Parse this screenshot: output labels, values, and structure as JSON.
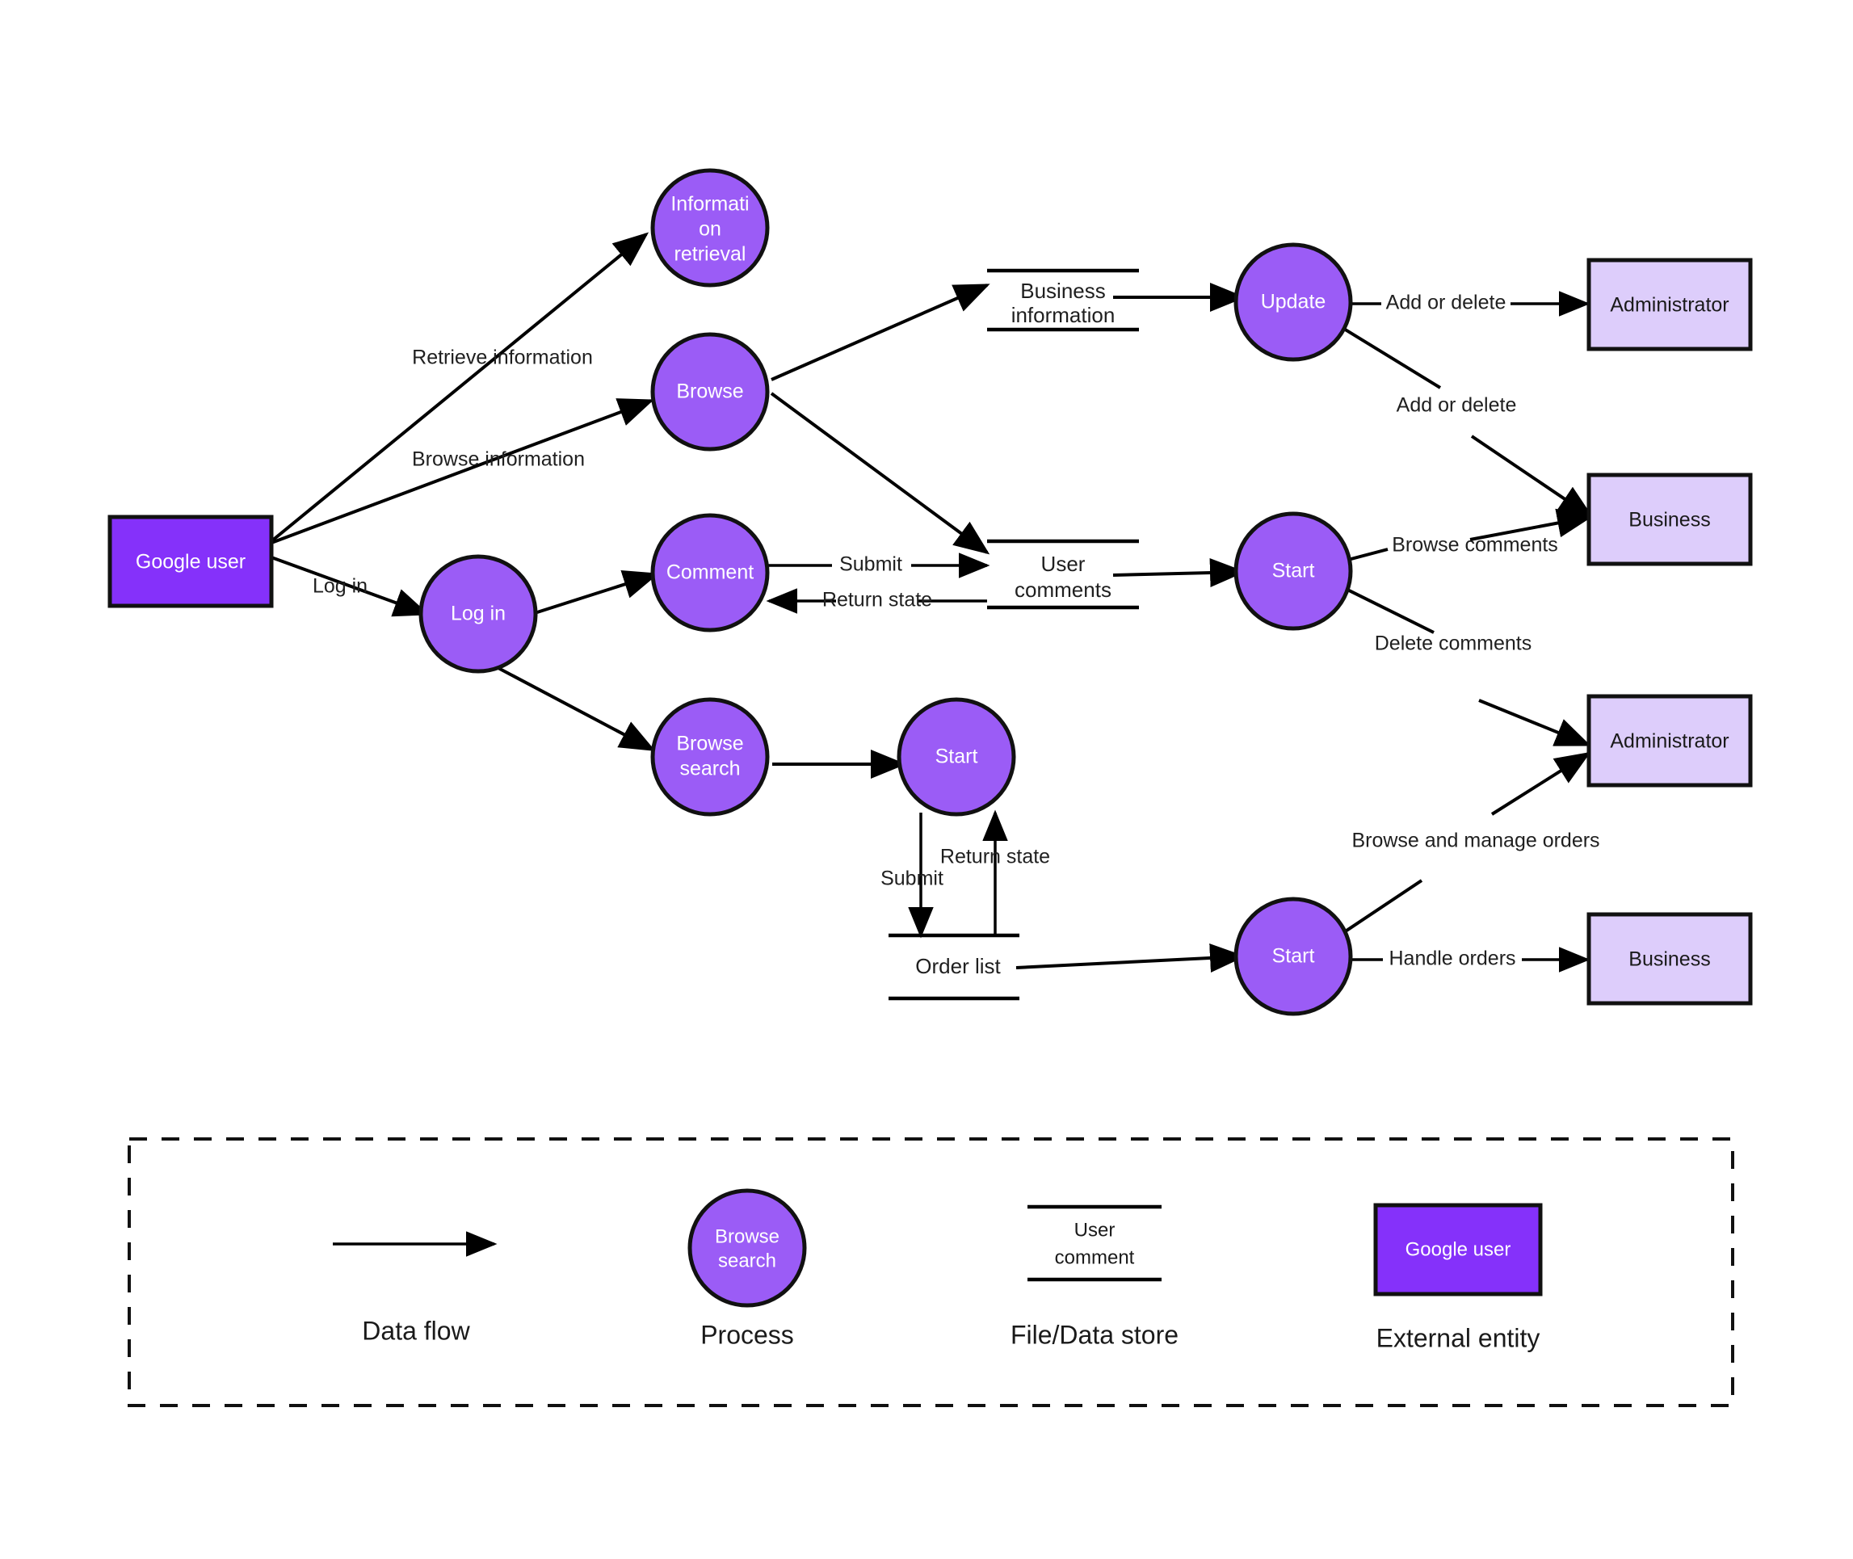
{
  "diagram": {
    "title": "Data Flow Diagram",
    "background_color": "#ffffff",
    "colors": {
      "process_fill": "#9b5cf6",
      "external_entity_fill": "#8531fa",
      "external_entity_light_fill": "#ddcdfb",
      "stroke": "#111111",
      "text_on_dark": "#ffffff",
      "text_on_light": "#1a1a1a"
    }
  },
  "external_entities": [
    {
      "id": "google_user",
      "label": "Google user",
      "variant": "strong"
    },
    {
      "id": "administrator_top",
      "label": "Administrator",
      "variant": "light"
    },
    {
      "id": "business_top",
      "label": "Business",
      "variant": "light"
    },
    {
      "id": "administrator_bottom",
      "label": "Administrator",
      "variant": "light"
    },
    {
      "id": "business_bottom",
      "label": "Business",
      "variant": "light"
    }
  ],
  "processes": [
    {
      "id": "information_retrieval",
      "lines": [
        "Informati",
        "on",
        "retrieval"
      ]
    },
    {
      "id": "browse",
      "lines": [
        "Browse"
      ]
    },
    {
      "id": "log_in",
      "lines": [
        "Log in"
      ]
    },
    {
      "id": "comment",
      "lines": [
        "Comment"
      ]
    },
    {
      "id": "browse_search",
      "lines": [
        "Browse",
        "search"
      ]
    },
    {
      "id": "update",
      "lines": [
        "Update"
      ]
    },
    {
      "id": "start_comments",
      "lines": [
        "Start"
      ]
    },
    {
      "id": "start_search",
      "lines": [
        "Start"
      ]
    },
    {
      "id": "start_orders",
      "lines": [
        "Start"
      ]
    }
  ],
  "data_stores": [
    {
      "id": "business_information",
      "lines": [
        "Business",
        "information"
      ]
    },
    {
      "id": "user_comments",
      "lines": [
        "User",
        "comments"
      ]
    },
    {
      "id": "order_list",
      "lines": [
        "Order list"
      ]
    }
  ],
  "flows": [
    {
      "id": "retrieve_information",
      "label": "Retrieve information",
      "from": "google_user",
      "to": "information_retrieval"
    },
    {
      "id": "browse_information",
      "label": "Browse information",
      "from": "google_user",
      "to": "browse"
    },
    {
      "id": "log_in_flow",
      "label": "Log in",
      "from": "google_user",
      "to": "log_in"
    },
    {
      "id": "browse_to_business_information",
      "label": "",
      "from": "browse",
      "to": "business_information"
    },
    {
      "id": "browse_to_user_comments",
      "label": "",
      "from": "browse",
      "to": "user_comments"
    },
    {
      "id": "log_in_to_comment",
      "label": "",
      "from": "log_in",
      "to": "comment"
    },
    {
      "id": "log_in_to_browse_search",
      "label": "",
      "from": "log_in",
      "to": "browse_search"
    },
    {
      "id": "comment_submit",
      "label": "Submit",
      "from": "comment",
      "to": "user_comments"
    },
    {
      "id": "comment_return_state",
      "label": "Return state",
      "from": "user_comments",
      "to": "comment"
    },
    {
      "id": "browse_search_to_start",
      "label": "",
      "from": "browse_search",
      "to": "start_search"
    },
    {
      "id": "search_submit",
      "label": "Submit",
      "from": "start_search",
      "to": "order_list"
    },
    {
      "id": "search_return_state",
      "label": "Return state",
      "from": "order_list",
      "to": "start_search"
    },
    {
      "id": "business_information_to_update",
      "label": "",
      "from": "business_information",
      "to": "update"
    },
    {
      "id": "user_comments_to_start",
      "label": "",
      "from": "user_comments",
      "to": "start_comments"
    },
    {
      "id": "order_list_to_start",
      "label": "",
      "from": "order_list",
      "to": "start_orders"
    },
    {
      "id": "update_add_or_delete_admin",
      "label": "Add or delete",
      "from": "update",
      "to": "administrator_top"
    },
    {
      "id": "update_add_or_delete_business",
      "label": "Add or delete",
      "from": "update",
      "to": "business_top"
    },
    {
      "id": "start_browse_comments",
      "label": "Browse comments",
      "from": "start_comments",
      "to": "business_top"
    },
    {
      "id": "start_delete_comments",
      "label": "Delete comments",
      "from": "start_comments",
      "to": "administrator_bottom"
    },
    {
      "id": "start_browse_manage_orders",
      "label": "Browse and manage orders",
      "from": "start_orders",
      "to": "administrator_bottom"
    },
    {
      "id": "start_handle_orders",
      "label": "Handle orders",
      "from": "start_orders",
      "to": "business_bottom"
    }
  ],
  "legend": {
    "items": [
      {
        "id": "data_flow",
        "caption": "Data flow",
        "sample": "arrow"
      },
      {
        "id": "process",
        "caption": "Process",
        "sample": "circle",
        "sample_lines": [
          "Browse",
          "search"
        ]
      },
      {
        "id": "file_data_store",
        "caption": "File/Data store",
        "sample": "store",
        "sample_lines": [
          "User",
          "comment"
        ]
      },
      {
        "id": "external_entity",
        "caption": "External entity",
        "sample": "rect",
        "sample_label": "Google user"
      }
    ]
  }
}
